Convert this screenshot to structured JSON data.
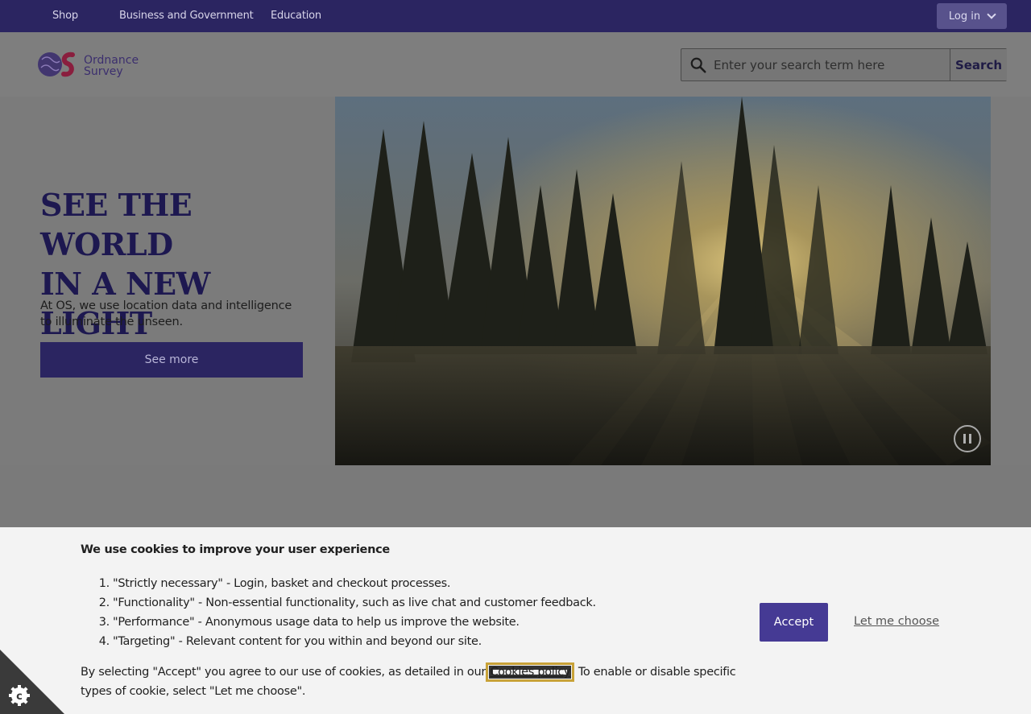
{
  "topnav": {
    "items": [
      {
        "label": "Shop"
      },
      {
        "label": "Business and Government"
      },
      {
        "label": "Education"
      }
    ],
    "login_label": "Log in"
  },
  "header": {
    "logo_text_1": "Ordnance",
    "logo_text_2": "Survey",
    "search_placeholder": "Enter your search term here",
    "search_button": "Search"
  },
  "hero": {
    "title_line1": "SEE THE WORLD",
    "title_line2": "IN A NEW LIGHT",
    "text": "At OS, we use location data and intelligence to illuminate the unseen.",
    "button": "See more"
  },
  "cookie": {
    "title": "We use cookies to improve your user experience",
    "items": [
      {
        "num": "1.",
        "text": "\"Strictly necessary\" - Login, basket and checkout processes."
      },
      {
        "num": "2.",
        "text": "\"Functionality\" - Non-essential functionality, such as live chat and customer feedback."
      },
      {
        "num": "3.",
        "text": "\"Performance\" - Anonymous usage data to help us improve the website."
      },
      {
        "num": "4.",
        "text": "\"Targeting\" - Relevant content for you within and beyond our site."
      }
    ],
    "foot_before": "By selecting \"Accept\" you agree to our use of cookies, as detailed in our ",
    "foot_link": "Cookies policy",
    "foot_after": ". To enable or disable specific types of cookie, select \"Let me choose\".",
    "accept": "Accept",
    "choose": "Let me choose"
  },
  "colors": {
    "brand_dark": "#2b2561",
    "accept": "#453a94",
    "focus_outline": "#c8a238"
  }
}
